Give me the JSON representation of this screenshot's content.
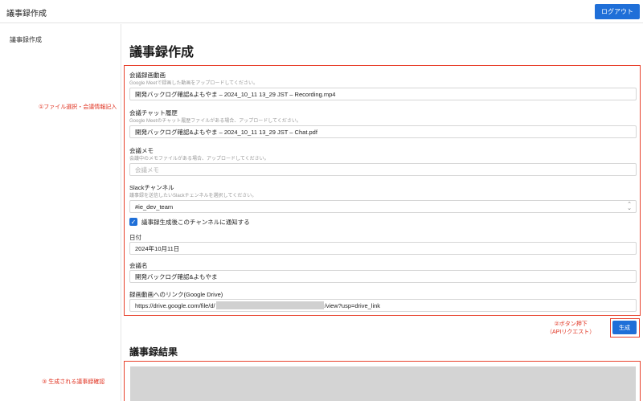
{
  "header": {
    "title": "議事録作成",
    "logout_label": "ログアウト"
  },
  "sidebar": {
    "items": [
      {
        "label": "議事録作成"
      }
    ]
  },
  "annotations": {
    "step1": "①ファイル選択・会議情報記入",
    "step2_line1": "②ボタン押下",
    "step2_line2": "（APIリクエスト）",
    "step3": "③ 生成される議事録確認"
  },
  "main": {
    "title": "議事録作成",
    "fields": {
      "video": {
        "label": "会議録画動画",
        "help": "Google Meetで録画した動画をアップロードしてください。",
        "value": "開発バックログ確認&よもやま – 2024_10_11 13_29 JST – Recording.mp4"
      },
      "chat": {
        "label": "会議チャット履歴",
        "help": "Google Meetのチャット履歴ファイルがある場合、アップロードしてください。",
        "value": "開発バックログ確認&よもやま – 2024_10_11 13_29 JST – Chat.pdf"
      },
      "memo": {
        "label": "会議メモ",
        "help": "会議中のメモファイルがある場合、アップロードしてください。",
        "placeholder": "会議メモ"
      },
      "slack": {
        "label": "Slackチャンネル",
        "help": "議事録を送信したいSlackチェンネルを選択してください。",
        "value": "#ie_dev_team"
      },
      "notify": {
        "label": "議事録生成後このチャンネルに通知する",
        "checked": true
      },
      "date": {
        "label": "日付",
        "value": "2024年10月11日"
      },
      "meeting_name": {
        "label": "会議名",
        "value": "開発バックログ確認&よもやま"
      },
      "drive_link": {
        "label": "録画動画へのリンク(Google Drive)",
        "value_prefix": "https://drive.google.com/file/d/",
        "value_suffix": "/view?usp=drive_link"
      }
    },
    "generate_label": "生成",
    "result_title": "議事録結果"
  },
  "colors": {
    "primary": "#1f6fd8",
    "annotation": "#e8412c",
    "redacted": "#d0d0d0"
  },
  "icons": {
    "checkbox": "checkmark-icon",
    "select": "select-arrows-icon"
  }
}
